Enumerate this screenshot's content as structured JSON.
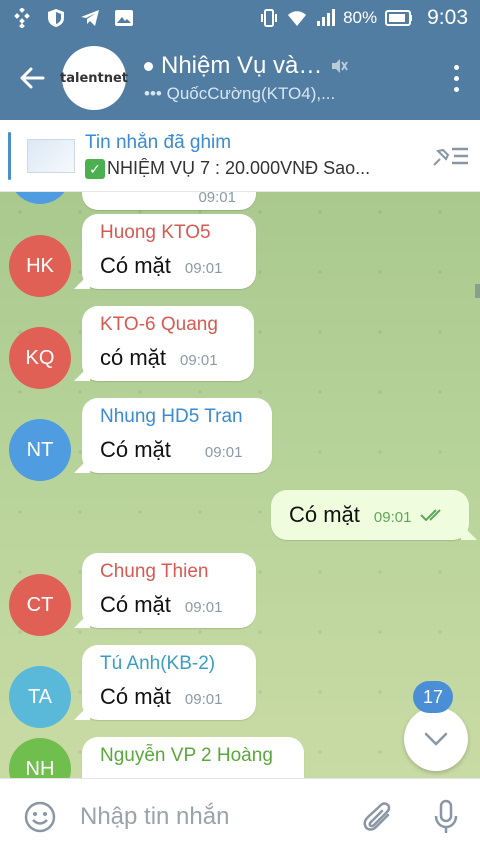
{
  "status_bar": {
    "battery": "80%",
    "time": "9:03"
  },
  "header": {
    "avatar_text": "talentnet",
    "title": "Nhiệm Vụ và…",
    "subtitle": "QuốcCường(KTO4),..."
  },
  "pinned": {
    "title": "Tin nhắn đã ghim",
    "message": "NHIỆM VỤ 7  : 20.000VNĐ Sao..."
  },
  "messages": [
    {
      "initials": "HK",
      "color": "#e06055",
      "name": "Huong KTO5",
      "name_color": "#d65a52",
      "text": "Có mặt",
      "time": "09:01"
    },
    {
      "initials": "KQ",
      "color": "#e06055",
      "name": "KTO-6 Quang",
      "name_color": "#d65a52",
      "text": "có mặt",
      "time": "09:01"
    },
    {
      "initials": "NT",
      "color": "#4f9de0",
      "name": "Nhung HD5 Tran",
      "name_color": "#3a8bd0",
      "text": "Có mặt",
      "time": "09:01"
    },
    {
      "initials": "CT",
      "color": "#e06055",
      "name": "Chung Thien",
      "name_color": "#d65a52",
      "text": "Có mặt",
      "time": "09:01"
    },
    {
      "initials": "TA",
      "color": "#5ab8d8",
      "name": "Tú Anh(KB-2)",
      "name_color": "#3a9ec4",
      "text": "Có mặt",
      "time": "09:01"
    },
    {
      "initials": "NH",
      "color": "#6fbe4e",
      "name": "Nguyễn VP 2 Hoàng",
      "name_color": "#5aa83c",
      "text": "",
      "time": ""
    }
  ],
  "partial_top_time": "09:01",
  "outgoing": {
    "text": "Có mặt",
    "time": "09:01"
  },
  "unread_count": "17",
  "input": {
    "placeholder": "Nhập tin nhắn"
  }
}
